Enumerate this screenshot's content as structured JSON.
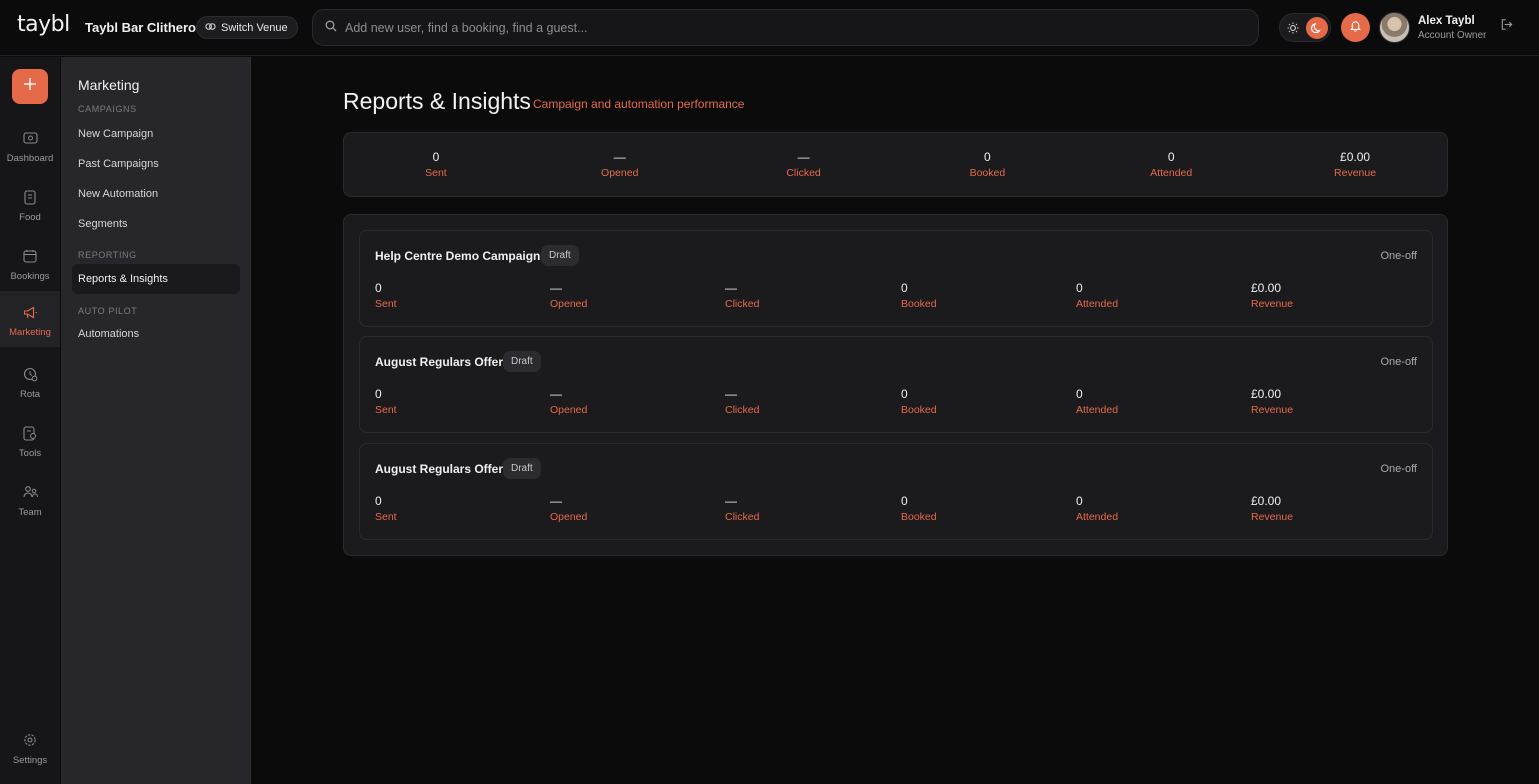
{
  "header": {
    "logo": "taybl",
    "venue": "Taybl Bar Clitheroe",
    "switch_label": "Switch Venue",
    "search_placeholder": "Add new user, find a booking, find a guest...",
    "user_name": "Alex Taybl",
    "user_role": "Account Owner"
  },
  "rail": {
    "items": [
      {
        "label": "Dashboard",
        "icon": "dashboard-icon"
      },
      {
        "label": "Food",
        "icon": "food-icon"
      },
      {
        "label": "Bookings",
        "icon": "bookings-icon"
      },
      {
        "label": "Marketing",
        "icon": "megaphone-icon",
        "active": true
      },
      {
        "label": "Rota",
        "icon": "rota-icon"
      },
      {
        "label": "Tools",
        "icon": "tools-icon"
      },
      {
        "label": "Team",
        "icon": "team-icon"
      }
    ],
    "settings_label": "Settings"
  },
  "sidebar": {
    "title": "Marketing",
    "campaigns_heading": "CAMPAIGNS",
    "new_campaign": "New Campaign",
    "past_campaigns": "Past Campaigns",
    "new_automation": "New Automation",
    "segments": "Segments",
    "reporting_heading": "REPORTING",
    "reports": "Reports & Insights",
    "autopilot_heading": "AUTO PILOT",
    "automations": "Automations"
  },
  "page": {
    "title": "Reports & Insights",
    "subtitle": "Campaign and automation performance"
  },
  "summary": [
    {
      "value": "0",
      "label": "Sent"
    },
    {
      "value": "—",
      "label": "Opened"
    },
    {
      "value": "—",
      "label": "Clicked"
    },
    {
      "value": "0",
      "label": "Booked"
    },
    {
      "value": "0",
      "label": "Attended"
    },
    {
      "value": "£0.00",
      "label": "Revenue"
    }
  ],
  "campaigns": [
    {
      "name": "Help Centre Demo Campaign",
      "status": "Draft",
      "type": "One-off",
      "metrics": [
        {
          "value": "0",
          "label": "Sent"
        },
        {
          "value": "—",
          "label": "Opened"
        },
        {
          "value": "—",
          "label": "Clicked"
        },
        {
          "value": "0",
          "label": "Booked"
        },
        {
          "value": "0",
          "label": "Attended"
        },
        {
          "value": "£0.00",
          "label": "Revenue"
        }
      ]
    },
    {
      "name": "August Regulars Offer",
      "status": "Draft",
      "type": "One-off",
      "metrics": [
        {
          "value": "0",
          "label": "Sent"
        },
        {
          "value": "—",
          "label": "Opened"
        },
        {
          "value": "—",
          "label": "Clicked"
        },
        {
          "value": "0",
          "label": "Booked"
        },
        {
          "value": "0",
          "label": "Attended"
        },
        {
          "value": "£0.00",
          "label": "Revenue"
        }
      ]
    },
    {
      "name": "August Regulars Offer",
      "status": "Draft",
      "type": "One-off",
      "metrics": [
        {
          "value": "0",
          "label": "Sent"
        },
        {
          "value": "—",
          "label": "Opened"
        },
        {
          "value": "—",
          "label": "Clicked"
        },
        {
          "value": "0",
          "label": "Booked"
        },
        {
          "value": "0",
          "label": "Attended"
        },
        {
          "value": "£0.00",
          "label": "Revenue"
        }
      ]
    }
  ],
  "colors": {
    "accent": "#e56a4a",
    "background": "#0b0b0c",
    "panel": "#1b1b1e"
  }
}
